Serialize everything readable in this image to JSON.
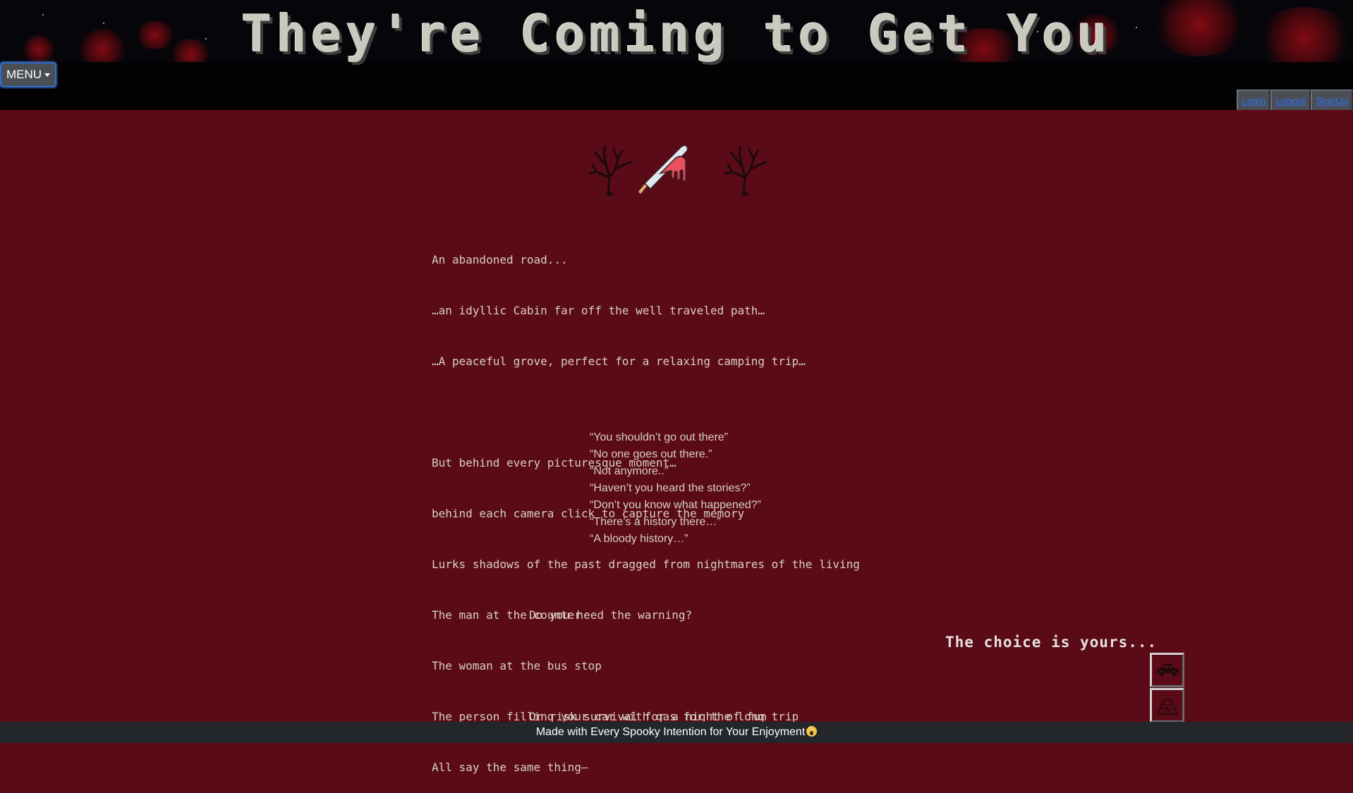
{
  "header": {
    "title": "They're Coming to Get You",
    "menu_label": "MENU",
    "auth_links": [
      "Login",
      "Logout",
      "SignUp"
    ]
  },
  "intro": {
    "lines": [
      "An abandoned road...",
      "…an idyllic Cabin far off the well traveled path…",
      "…A peaceful grove, perfect for a relaxing camping trip…",
      "",
      "But behind every picturesque moment…",
      "behind each camera click to capture the memory",
      "Lurks shadows of the past dragged from nightmares of the living",
      "The man at the counter",
      "The woman at the bus stop",
      "The person filling your car with gas for the long trip",
      "All say the same thing–"
    ]
  },
  "quotes": [
    "“You shouldn’t go out there”",
    "“No one goes out there.”",
    "“Not anymore..”",
    "“Haven’t you heard the stories?”",
    "“Don’t you know what happened?”",
    "“There’s a history there…”",
    "“A bloody history…”"
  ],
  "question": {
    "heed": "Do you heed the warning?",
    "risk": "Or risk survival for a night of fun"
  },
  "choice": {
    "heading": "The choice is yours...",
    "options": [
      "car-icon",
      "tent-icon"
    ]
  },
  "footer": {
    "text": "Made with Every Spooky Intention for Your Enjoyment"
  },
  "icons": [
    "dead-tree-icon",
    "bloody-knife-icon"
  ],
  "colors": {
    "header_bg": "#020203",
    "main_bg": "#5a0b17",
    "title_text": "#c9c9c0",
    "body_text": "#d8cfc6",
    "link": "#2b6ff0",
    "footer_bg": "#23272b"
  }
}
